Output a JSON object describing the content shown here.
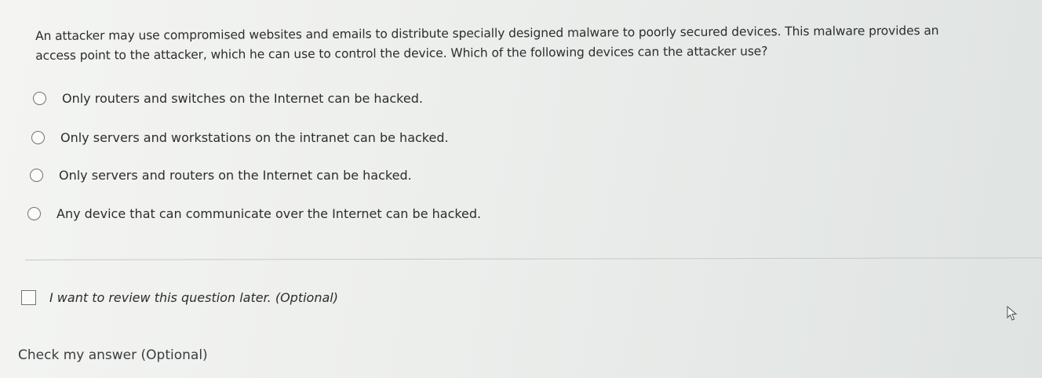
{
  "question": {
    "line1": "An attacker may use compromised websites and emails to distribute specially designed malware to poorly secured devices. This malware provides an",
    "line2": "access point to the attacker, which he can use to control the device. Which of the following devices can the attacker use?"
  },
  "options": [
    {
      "label": "Only routers and switches on the Internet can be hacked.",
      "selected": false
    },
    {
      "label": "Only servers and workstations on the intranet can be hacked.",
      "selected": false
    },
    {
      "label": "Only servers and routers on the Internet can be hacked.",
      "selected": false
    },
    {
      "label": "Any device that can communicate over the Internet can be hacked.",
      "selected": false
    }
  ],
  "review": {
    "label": "I want to review this question later. (Optional)",
    "checked": false
  },
  "check_answer": {
    "label": "Check my answer (Optional)"
  },
  "icons": {
    "radio": "radio-button-icon",
    "checkbox": "checkbox-icon",
    "cursor": "mouse-pointer-icon"
  }
}
